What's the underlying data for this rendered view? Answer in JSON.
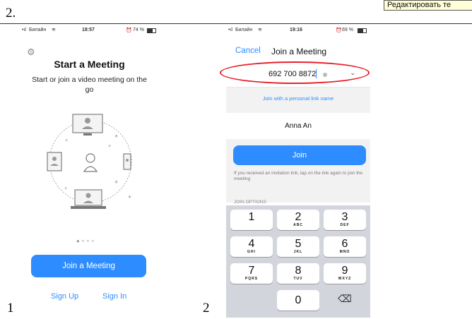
{
  "document": {
    "section_label": "2.",
    "tooltip_text": "Редактировать те",
    "figure_label_1": "1",
    "figure_label_2": "2"
  },
  "phone1": {
    "status": {
      "carrier": "Билайн",
      "time": "18:57",
      "battery": "74 %"
    },
    "title": "Start a Meeting",
    "subtitle": "Start or join a video meeting on the go",
    "join_button": "Join a Meeting",
    "sign_up": "Sign Up",
    "sign_in": "Sign In"
  },
  "phone2": {
    "status": {
      "carrier": "Билайн",
      "time": "19:16",
      "battery": "69 %"
    },
    "cancel": "Cancel",
    "title": "Join a Meeting",
    "meeting_id": "692 700 8872",
    "personal_link": "Join with a personal link name",
    "name": "Anna An",
    "join_button": "Join",
    "hint": "If you received an invitation link, tap on the link again to join the meeting",
    "join_options": "JOIN OPTIONS",
    "keypad": [
      {
        "num": "1",
        "letters": ""
      },
      {
        "num": "2",
        "letters": "ABC"
      },
      {
        "num": "3",
        "letters": "DEF"
      },
      {
        "num": "4",
        "letters": "GHI"
      },
      {
        "num": "5",
        "letters": "JKL"
      },
      {
        "num": "6",
        "letters": "MNO"
      },
      {
        "num": "7",
        "letters": "PQRS"
      },
      {
        "num": "8",
        "letters": "TUV"
      },
      {
        "num": "9",
        "letters": "WXYZ"
      },
      {
        "num": "0",
        "letters": ""
      }
    ]
  },
  "colors": {
    "accent": "#2d8cff",
    "annotation": "#e8202a",
    "keypad_bg": "#d2d5db"
  }
}
